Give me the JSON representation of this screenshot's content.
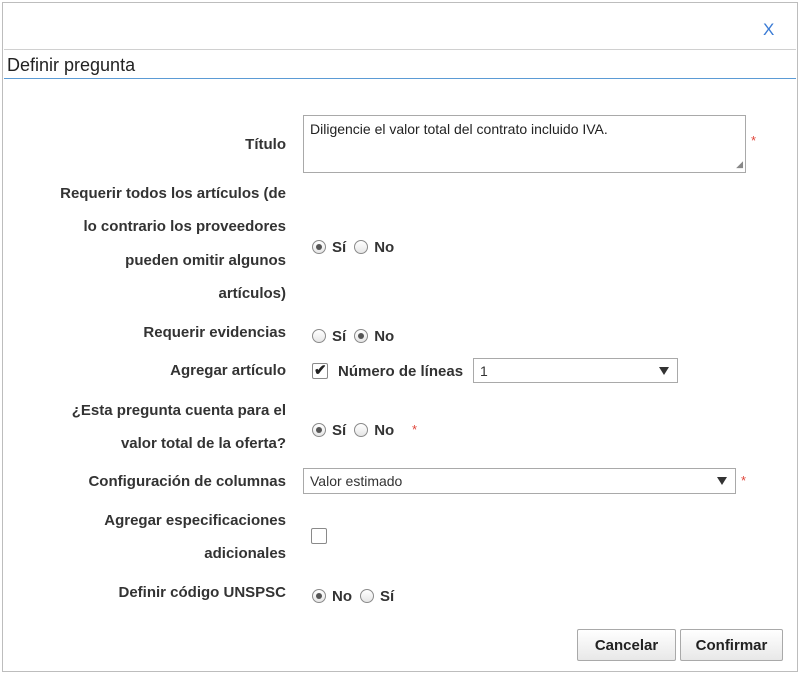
{
  "dialog": {
    "close_label": "X",
    "title": "Definir pregunta"
  },
  "form": {
    "titulo": {
      "label": "Título",
      "value": "Diligencie el valor total del contrato incluido IVA.",
      "required_mark": "*"
    },
    "requerir_articulos": {
      "label_lines": [
        "Requerir todos los artículos (de",
        "lo contrario los proveedores",
        "pueden omitir algunos",
        "artículos)"
      ],
      "options": [
        "Sí",
        "No"
      ],
      "selected": "Sí"
    },
    "requerir_evidencias": {
      "label": "Requerir evidencias",
      "options": [
        "Sí",
        "No"
      ],
      "selected": "No"
    },
    "agregar_articulo": {
      "label": "Agregar artículo",
      "checked": true,
      "lineas_label": "Número de líneas",
      "lineas_value": "1"
    },
    "cuenta_valor_total": {
      "label_lines": [
        "¿Esta pregunta cuenta para el",
        "valor total de la oferta?"
      ],
      "options": [
        "Sí",
        "No"
      ],
      "selected": "Sí",
      "required_mark": "*"
    },
    "config_columnas": {
      "label": "Configuración de columnas",
      "value": "Valor estimado",
      "required_mark": "*"
    },
    "especificaciones": {
      "label_lines": [
        "Agregar especificaciones",
        "adicionales"
      ],
      "checked": false
    },
    "unspsc": {
      "label": "Definir código UNSPSC",
      "options": [
        "No",
        "Sí"
      ],
      "selected": "No"
    }
  },
  "buttons": {
    "cancel": "Cancelar",
    "confirm": "Confirmar"
  },
  "colors": {
    "accent": "#5b9bd5",
    "required": "#e0453a",
    "close": "#3a7bd5"
  }
}
